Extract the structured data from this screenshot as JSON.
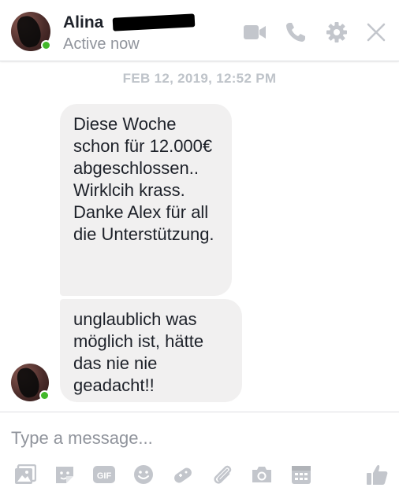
{
  "header": {
    "name": "Alina",
    "status": "Active now",
    "icons": [
      "video-camera-icon",
      "phone-icon",
      "gear-icon",
      "close-icon"
    ]
  },
  "conversation": {
    "timestamp": "FEB 12, 2019, 12:52 PM",
    "messages": [
      {
        "text": "Diese Woche schon für 12.000€ abgeschlossen.. Wirklcih krass. Danke Alex für all die Unterstützung."
      },
      {
        "text": "unglaublich was möglich ist, hätte das nie nie geadacht!!"
      }
    ]
  },
  "composer": {
    "placeholder": "Type a message...",
    "tool_icons": [
      "image-icon",
      "sticker-icon",
      "gif-icon",
      "emoji-icon",
      "game-controller-icon",
      "paperclip-icon",
      "camera-icon",
      "calendar-icon",
      "thumbs-up-icon"
    ]
  },
  "colors": {
    "accent": "#c3c6cc",
    "online": "#42b72a",
    "bubble": "#f1f0f0"
  }
}
